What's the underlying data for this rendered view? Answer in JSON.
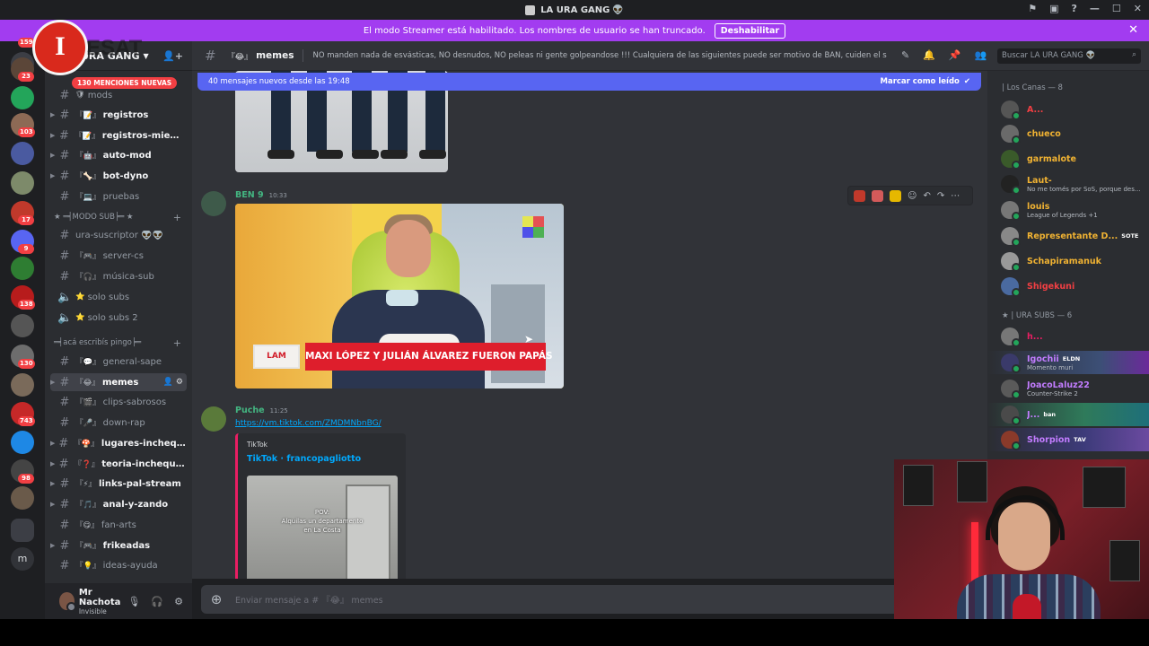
{
  "window": {
    "title": "LA URA GANG",
    "title_emoji": "👽"
  },
  "streamer_banner": {
    "text": "El modo Streamer está habilitado. Los nombres de usuario se han truncado.",
    "button": "Deshabilitar"
  },
  "server_rail": {
    "badges": [
      "159",
      "23",
      "103",
      "17",
      "9",
      "138",
      "130",
      "743",
      "98"
    ]
  },
  "server": {
    "name": "URA GANG",
    "mentions_pill": "130 MENCIONES NUEVAS"
  },
  "channels": [
    {
      "emoji": "🛡",
      "name": "mods",
      "arrow": false,
      "style": "dim"
    },
    {
      "emoji": "『📝』",
      "name": "registros",
      "arrow": true,
      "style": "bright"
    },
    {
      "emoji": "『📝』",
      "name": "registros-miem...",
      "arrow": true,
      "style": "bright"
    },
    {
      "emoji": "『🤖』",
      "name": "auto-mod",
      "arrow": true,
      "style": "bright"
    },
    {
      "emoji": "『🦴』",
      "name": "bot-dyno",
      "arrow": true,
      "style": "bright"
    },
    {
      "emoji": "『💻』",
      "name": "pruebas",
      "arrow": false,
      "style": "dim"
    },
    {
      "emoji": "",
      "name": "ura-suscriptor 👽👽",
      "arrow": false,
      "style": "dim"
    },
    {
      "emoji": "『🎮』",
      "name": "server-cs",
      "arrow": false,
      "style": "dim"
    },
    {
      "emoji": "『🎧』",
      "name": "música-sub",
      "arrow": false,
      "style": "dim"
    },
    {
      "emoji": "⭐",
      "name": "solo subs",
      "arrow": false,
      "style": "dim",
      "voice": true
    },
    {
      "emoji": "⭐",
      "name": "solo subs 2",
      "arrow": false,
      "style": "dim",
      "voice": true
    },
    {
      "emoji": "『💬』",
      "name": "general-sape",
      "arrow": false,
      "style": "dim"
    },
    {
      "emoji": "『😂』",
      "name": "memes",
      "arrow": true,
      "style": "active"
    },
    {
      "emoji": "『🎬』",
      "name": "clips-sabrosos",
      "arrow": false,
      "style": "dim"
    },
    {
      "emoji": "『🎤』",
      "name": "down-rap",
      "arrow": false,
      "style": "dim"
    },
    {
      "emoji": "『🍄』",
      "name": "lugares-inchequ...",
      "arrow": true,
      "style": "bright"
    },
    {
      "emoji": "『❓』",
      "name": "teoria-incheque...",
      "arrow": true,
      "style": "bright"
    },
    {
      "emoji": "『⚡』",
      "name": "links-pal-stream",
      "arrow": true,
      "style": "bright"
    },
    {
      "emoji": "『🎵』",
      "name": "anal-y-zando",
      "arrow": true,
      "style": "bright"
    },
    {
      "emoji": "『😋』",
      "name": "fan-arts",
      "arrow": false,
      "style": "dim"
    },
    {
      "emoji": "『🎮』",
      "name": "frikeadas",
      "arrow": true,
      "style": "bright"
    },
    {
      "emoji": "『💡』",
      "name": "ideas-ayuda",
      "arrow": false,
      "style": "dim"
    }
  ],
  "categories": {
    "sub": "★ ═╡MODO SUB╞═ ★",
    "pingo": "═╡acá escribís pingo╞═"
  },
  "user_panel": {
    "name": "Mr Nachota",
    "status": "Invisible"
  },
  "header": {
    "channel_emoji": "『😂』",
    "channel": "memes",
    "topic": "NO manden nada de esvásticas, NO desnudos, NO peleas ni gente golpeandose !!! Cualquiera de las siguientes puede ser motivo de BAN, cuiden el stream!",
    "search_placeholder": "Buscar LA URA GANG 👽"
  },
  "new_messages": {
    "text": "40 mensajes nuevos desde las 19:48",
    "action": "Marcar como leído"
  },
  "messages": [
    {
      "author": "BEN 9",
      "author_color": "#43b581",
      "time": "10:33",
      "video_caption": "MAXI LÓPEZ Y JULIÁN ÁLVAREZ FUERON PAPÁS",
      "video_channel": "LAM"
    },
    {
      "author": "Puche",
      "author_color": "#43b581",
      "time": "11:25",
      "link": "https://vm.tiktok.com/ZMDMNbnBG/",
      "embed_provider": "TikTok",
      "embed_title": "TikTok · francopagliotto",
      "thumb_caption_1": "POV:",
      "thumb_caption_2": "Alquilas un departamento",
      "thumb_caption_3": "en La Costa"
    }
  ],
  "composer": {
    "placeholder": "Enviar mensaje a # 『😂』 memes"
  },
  "members": {
    "group1": "| Los Canas — 8",
    "group2": "★ | URA SUBS — 6",
    "list1": [
      {
        "name": "A...",
        "color": "#f23f43",
        "activity": ""
      },
      {
        "name": "chueco",
        "color": "#f0b232",
        "activity": ""
      },
      {
        "name": "garmalote",
        "color": "#f0b232",
        "activity": ""
      },
      {
        "name": "Laut-",
        "color": "#f0b232",
        "activity": "No me tomés por SoS, porque des..."
      },
      {
        "name": "louis",
        "color": "#f0b232",
        "activity": "League of Legends +1"
      },
      {
        "name": "Representante D...",
        "color": "#f0b232",
        "activity": "",
        "tag": "SOTE"
      },
      {
        "name": "Schapiramanuk",
        "color": "#f0b232",
        "activity": ""
      },
      {
        "name": "Shigekuni",
        "color": "#f23f43",
        "activity": ""
      }
    ],
    "list2": [
      {
        "name": "h...",
        "color": "#e91e63",
        "activity": ""
      },
      {
        "name": "Igochii",
        "color": "#c27cff",
        "activity": "Momento muri",
        "tag": "ELDN"
      },
      {
        "name": "JoacoLaluz22",
        "color": "#c27cff",
        "activity": "Counter-Strike 2"
      },
      {
        "name": "J...",
        "color": "#c27cff",
        "activity": "",
        "tag": "ban"
      },
      {
        "name": "Shorpion",
        "color": "#c27cff",
        "activity": "",
        "tag": "TAV"
      }
    ]
  },
  "watermark": {
    "letter": "I",
    "text": "ESAT"
  },
  "colors": {
    "banner": "#a23cf0",
    "new_bar": "#5865f2",
    "link": "#00a8fc"
  }
}
